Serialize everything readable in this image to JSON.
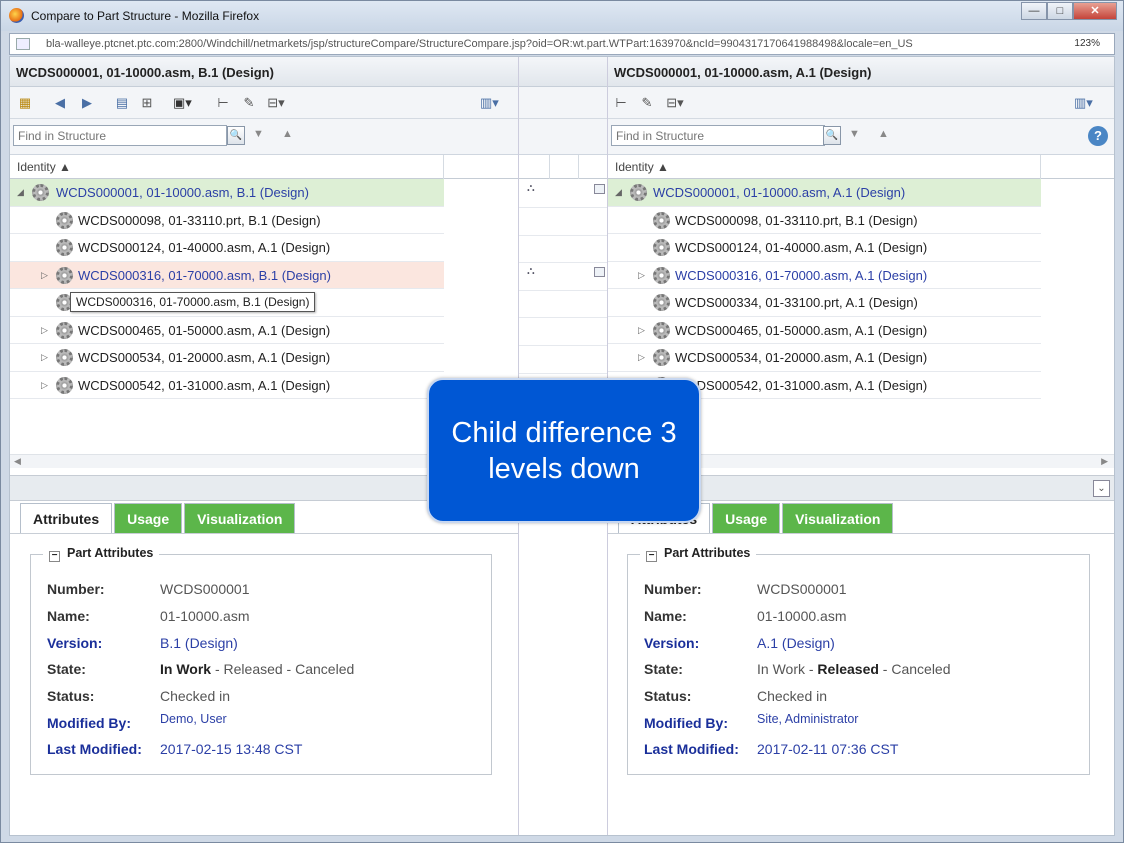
{
  "window": {
    "title": "Compare to Part Structure - Mozilla Firefox",
    "url": "bla-walleye.ptcnet.ptc.com:2800/Windchill/netmarkets/jsp/structureCompare/StructureCompare.jsp?oid=OR:wt.part.WTPart:163970&ncId=9904317170641988498&locale=en_US",
    "zoom": "123%",
    "controls": {
      "minimize": "—",
      "maximize": "□",
      "close": "✕"
    }
  },
  "left": {
    "header": "WCDS000001, 01-10000.asm, B.1 (Design)",
    "find_placeholder": "Find in Structure",
    "column": "Identity ▲",
    "rows": [
      "WCDS000001, 01-10000.asm, B.1 (Design)",
      "WCDS000098, 01-33110.prt, B.1 (Design)",
      "WCDS000124, 01-40000.asm, A.1 (Design)",
      "WCDS000316, 01-70000.asm, B.1 (Design)",
      "WCDS000334, 01-33100.prt, A.1 (Design)",
      "WCDS000465, 01-50000.asm, A.1 (Design)",
      "WCDS000534, 01-20000.asm, A.1 (Design)",
      "WCDS000542, 01-31000.asm, A.1 (Design)"
    ],
    "tooltip": "WCDS000316, 01-70000.asm, B.1 (Design)",
    "tabs": {
      "attributes": "Attributes",
      "usage": "Usage",
      "visualization": "Visualization"
    },
    "panel_title": "Part Attributes",
    "labels": {
      "number": "Number:",
      "name": "Name:",
      "version": "Version:",
      "state": "State:",
      "status": "Status:",
      "modified_by": "Modified By:",
      "last_modified": "Last Modified:"
    },
    "values": {
      "number": "WCDS000001",
      "name": "01-10000.asm",
      "version": "B.1 (Design)",
      "state_current": "In Work",
      "state_rest": " - Released - Canceled",
      "status": "Checked in",
      "modified_by": "Demo, User",
      "last_modified": "2017-02-15 13:48 CST"
    }
  },
  "right": {
    "header": "WCDS000001, 01-10000.asm, A.1 (Design)",
    "find_placeholder": "Find in Structure",
    "column": "Identity ▲",
    "rows": [
      "WCDS000001, 01-10000.asm, A.1 (Design)",
      "WCDS000098, 01-33110.prt, B.1 (Design)",
      "WCDS000124, 01-40000.asm, A.1 (Design)",
      "WCDS000316, 01-70000.asm, A.1 (Design)",
      "WCDS000334, 01-33100.prt, A.1 (Design)",
      "WCDS000465, 01-50000.asm, A.1 (Design)",
      "WCDS000534, 01-20000.asm, A.1 (Design)",
      "WCDS000542, 01-31000.asm, A.1 (Design)"
    ],
    "tabs": {
      "attributes": "Attributes",
      "usage": "Usage",
      "visualization": "Visualization"
    },
    "panel_title": "Part Attributes",
    "labels": {
      "number": "Number:",
      "name": "Name:",
      "version": "Version:",
      "state": "State:",
      "status": "Status:",
      "modified_by": "Modified By:",
      "last_modified": "Last Modified:"
    },
    "values": {
      "number": "WCDS000001",
      "name": "01-10000.asm",
      "version": "A.1 (Design)",
      "state_pre": "In Work - ",
      "state_current": "Released",
      "state_post": " - Canceled",
      "status": "Checked in",
      "modified_by": "Site, Administrator",
      "last_modified": "2017-02-11 07:36 CST"
    }
  },
  "callout": {
    "line1": "Child difference 3",
    "line2": "levels down",
    "color": "#0057d4"
  },
  "colors": {
    "root_row": "#ddefd5",
    "highlight_row": "#fbe6df",
    "tab_green": "#5cb64a",
    "link": "#2b3fa6"
  }
}
